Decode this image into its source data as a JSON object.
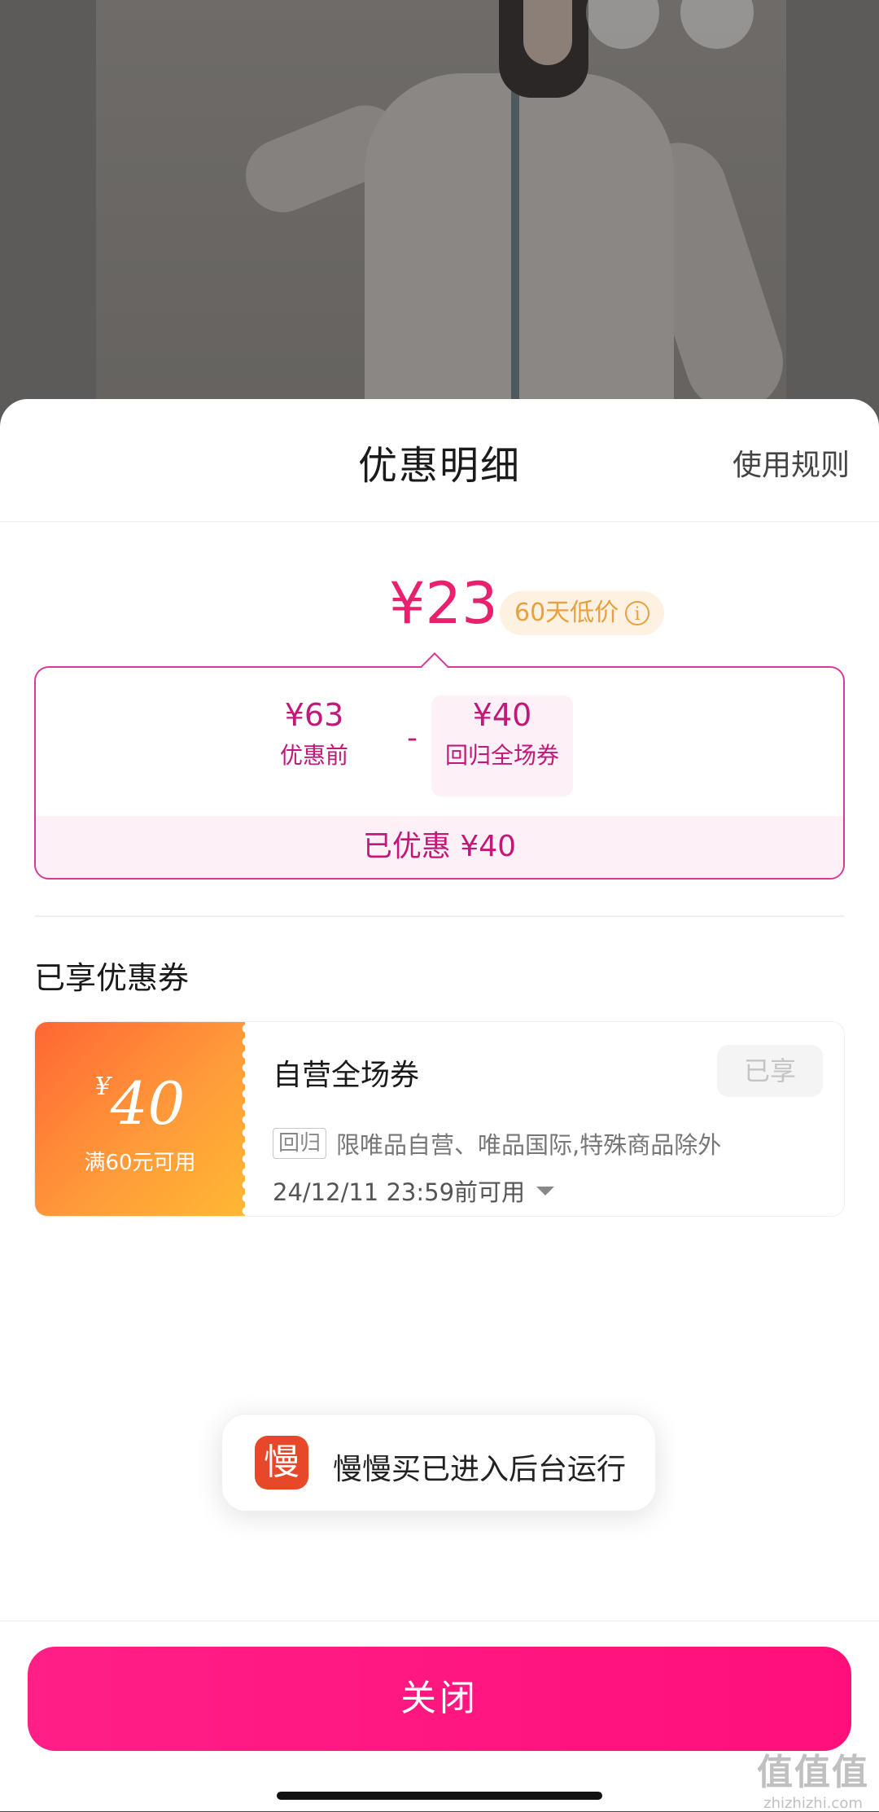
{
  "sheet": {
    "title": "优惠明细",
    "rules_link": "使用规则"
  },
  "price": {
    "final": "¥23",
    "badge": "60天低价",
    "badge_icon": "info-icon"
  },
  "calc": {
    "original_value": "¥63",
    "original_label": "优惠前",
    "minus": "-",
    "coupon_value": "¥40",
    "coupon_label": "回归全场券",
    "saved": "已优惠 ¥40"
  },
  "coupons_section": {
    "title": "已享优惠券",
    "items": [
      {
        "yen": "¥",
        "amount": "40",
        "condition": "满60元可用",
        "name": "自营全场券",
        "status": "已享",
        "tag": "回归",
        "scope": "限唯品自营、唯品国际,特殊商品除外",
        "expire": "24/12/11 23:59前可用"
      }
    ]
  },
  "toast": {
    "icon_char": "慢",
    "text": "慢慢买已进入后台运行"
  },
  "close_button": "关闭",
  "watermark": {
    "big": "值值值",
    "small": "zhizhizhi.com"
  },
  "colors": {
    "accent": "#e8206d",
    "close_button": "#ff0f7a",
    "coupon_gradient_start": "#ff6633",
    "coupon_gradient_end": "#ffb833"
  }
}
